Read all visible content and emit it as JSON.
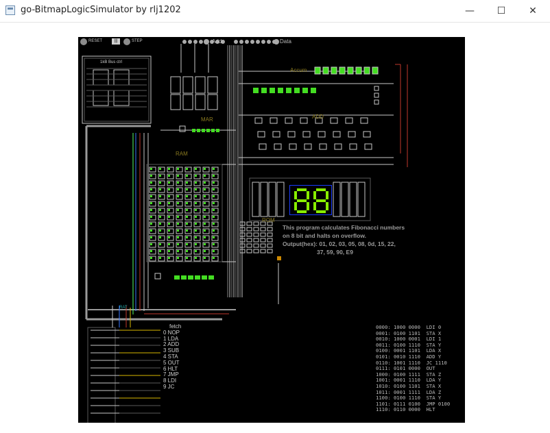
{
  "window": {
    "title": "go-BitmapLogicSimulator by rlj1202",
    "controls": {
      "minimize": "—",
      "maximize": "☐",
      "close": "✕"
    }
  },
  "toolbar": {
    "reset": "RESET",
    "mode": "|||",
    "step": "STEP"
  },
  "buses": {
    "addr": "Addr",
    "data": "Data"
  },
  "blocks": {
    "mar": "MAR",
    "ram": "RAM",
    "rom": "ROM",
    "accum": "Accum",
    "add": "ADD",
    "clock": "1kB Bus ctrl",
    "ctrl": "RAT"
  },
  "display": {
    "value": "88"
  },
  "info": {
    "lines": [
      "This program calculates Fibonacci numbers",
      "on 8 bit and halts on overflow.",
      "Output(hex): 01, 02, 03, 05, 08, 0d, 15, 22,",
      "37, 59, 90, E9"
    ]
  },
  "opcodes": [
    "fetch",
    "0 NOP",
    "1 LDA",
    "2 ADD",
    "3 SUB",
    "4 STA",
    "5 OUT",
    "6 HLT",
    "7 JMP",
    "8 LDI",
    "9 JC"
  ],
  "program": [
    "0000: 1000 0000  LDI 0",
    "0001: 0100 1101  STA X",
    "0010: 1000 0001  LDI 1",
    "0011: 0100 1110  STA Y",
    "0100: 0001 1101  LDA X",
    "0101: 0010 1110  ADD Y",
    "0110: 1001 1110  JC 1110",
    "0111: 0101 0000  OUT",
    "1000: 0100 1111  STA Z",
    "1001: 0001 1110  LDA Y",
    "1010: 0100 1101  STA X",
    "1011: 0001 1111  LDA Z",
    "1100: 0100 1110  STA Y",
    "1101: 0111 0100  JMP 0100",
    "1110: 0110 0000  HLT"
  ],
  "colors": {
    "board": "#000000",
    "wire": "#c8c8c8",
    "wire_dim": "#5a5a5a",
    "led_on": "#44dd22",
    "label_olive": "#8a7a20",
    "segment": "#88ee00",
    "display_frame": "#1a3cff",
    "red_wire": "#c0392b",
    "blue_wire": "#3a78ff",
    "yellow_wire": "#d8b800"
  }
}
